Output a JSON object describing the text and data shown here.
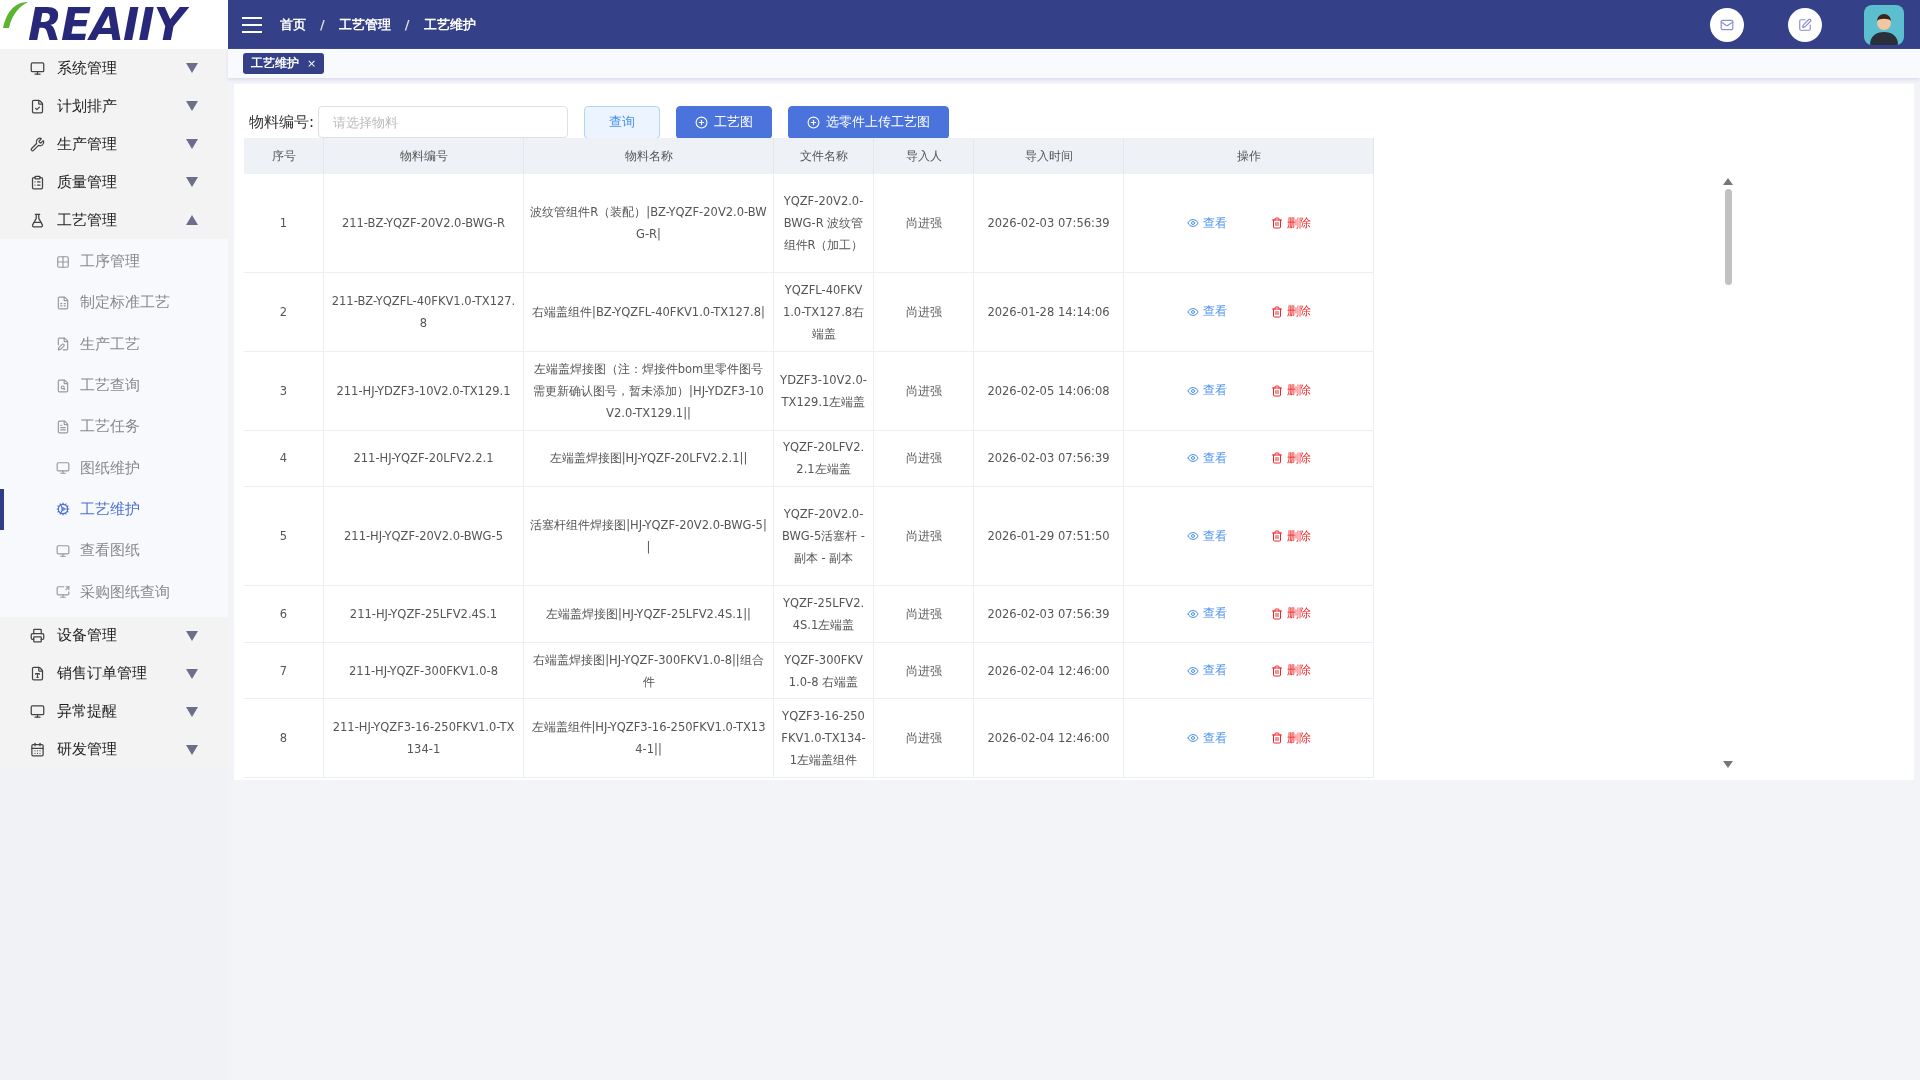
{
  "logo": "REAIIY",
  "breadcrumb": [
    {
      "label": "首页"
    },
    {
      "label": "工艺管理",
      "separator": "/"
    },
    {
      "label": "工艺维护",
      "separator": "/"
    }
  ],
  "tabs": [
    {
      "label": "工艺维护",
      "close": "×",
      "selected": true
    }
  ],
  "sidebar": {
    "items": [
      {
        "label": "系统管理",
        "expanded": false
      },
      {
        "label": "计划排产",
        "expanded": false
      },
      {
        "label": "生产管理",
        "expanded": false
      },
      {
        "label": "质量管理",
        "expanded": false
      },
      {
        "label": "工艺管理",
        "expanded": true,
        "children": [
          {
            "label": "工序管理",
            "selected": false
          },
          {
            "label": "制定标准工艺",
            "selected": false
          },
          {
            "label": "生产工艺",
            "selected": false
          },
          {
            "label": "工艺查询",
            "selected": false
          },
          {
            "label": "工艺任务",
            "selected": false
          },
          {
            "label": "图纸维护",
            "selected": false
          },
          {
            "label": "工艺维护",
            "selected": true
          },
          {
            "label": "查看图纸",
            "selected": false
          },
          {
            "label": "采购图纸查询",
            "selected": false
          }
        ]
      },
      {
        "label": "设备管理",
        "expanded": false
      },
      {
        "label": "销售订单管理",
        "expanded": false
      },
      {
        "label": "异常提醒",
        "expanded": false
      },
      {
        "label": "研发管理",
        "expanded": false
      }
    ]
  },
  "search": {
    "label": "物料编号:",
    "placeholder": "请选择物料"
  },
  "buttons": [
    {
      "label": "查询",
      "kind": "plain"
    },
    {
      "label": "工艺图",
      "kind": "add"
    },
    {
      "label": "选零件上传工艺图",
      "kind": "add"
    }
  ],
  "table": {
    "columns": [
      "序号",
      "物料编号",
      "物料名称",
      "文件名称",
      "导入人",
      "导入时间",
      "操作"
    ],
    "rows": [
      {
        "no": "1",
        "code": "211-BZ-YQZF-20V2.0-BWG-R",
        "name": "波纹管组件R（装配）|BZ-YQZF-20V2.0-BWG-R|",
        "file": "YQZF-20V2.0-BWG-R 波纹管组件R（加工）",
        "importer": "尚进强",
        "time": "2026-02-03 07:56:39",
        "view": "查看",
        "delete": "删除"
      },
      {
        "no": "2",
        "code": "211-BZ-YQZFL-40FKV1.0-TX127.8",
        "name": "右端盖组件|BZ-YQZFL-40FKV1.0-TX127.8|",
        "file": "YQZFL-40FKV1.0-TX127.8右端盖",
        "importer": "尚进强",
        "time": "2026-01-28 14:14:06",
        "view": "查看",
        "delete": "删除"
      },
      {
        "no": "3",
        "code": "211-HJ-YDZF3-10V2.0-TX129.1",
        "name": "左端盖焊接图（注：焊接件bom里零件图号需更新确认图号，暂未添加）|HJ-YDZF3-10V2.0-TX129.1||",
        "file": "YDZF3-10V2.0-TX129.1左端盖",
        "importer": "尚进强",
        "time": "2026-02-05 14:06:08",
        "view": "查看",
        "delete": "删除"
      },
      {
        "no": "4",
        "code": "211-HJ-YQZF-20LFV2.2.1",
        "name": "左端盖焊接图|HJ-YQZF-20LFV2.2.1||",
        "file": "YQZF-20LFV2.2.1左端盖",
        "importer": "尚进强",
        "time": "2026-02-03 07:56:39",
        "view": "查看",
        "delete": "删除"
      },
      {
        "no": "5",
        "code": "211-HJ-YQZF-20V2.0-BWG-5",
        "name": "活塞杆组件焊接图|HJ-YQZF-20V2.0-BWG-5||",
        "file": "YQZF-20V2.0-BWG-5活塞杆 - 副本 - 副本",
        "importer": "尚进强",
        "time": "2026-01-29 07:51:50",
        "view": "查看",
        "delete": "删除"
      },
      {
        "no": "6",
        "code": "211-HJ-YQZF-25LFV2.4S.1",
        "name": "左端盖焊接图|HJ-YQZF-25LFV2.4S.1||",
        "file": "YQZF-25LFV2.4S.1左端盖",
        "importer": "尚进强",
        "time": "2026-02-03 07:56:39",
        "view": "查看",
        "delete": "删除"
      },
      {
        "no": "7",
        "code": "211-HJ-YQZF-300FKV1.0-8",
        "name": "右端盖焊接图|HJ-YQZF-300FKV1.0-8||组合件",
        "file": "YQZF-300FKV1.0-8 右端盖",
        "importer": "尚进强",
        "time": "2026-02-04 12:46:00",
        "view": "查看",
        "delete": "删除"
      },
      {
        "no": "8",
        "code": "211-HJ-YQZF3-16-250FKV1.0-TX134-1",
        "name": "左端盖组件|HJ-YQZF3-16-250FKV1.0-TX134-1||",
        "file": "YQZF3-16-250FKV1.0-TX134-1左端盖组件",
        "importer": "尚进强",
        "time": "2026-02-04 12:46:00",
        "view": "查看",
        "delete": "删除"
      }
    ]
  }
}
